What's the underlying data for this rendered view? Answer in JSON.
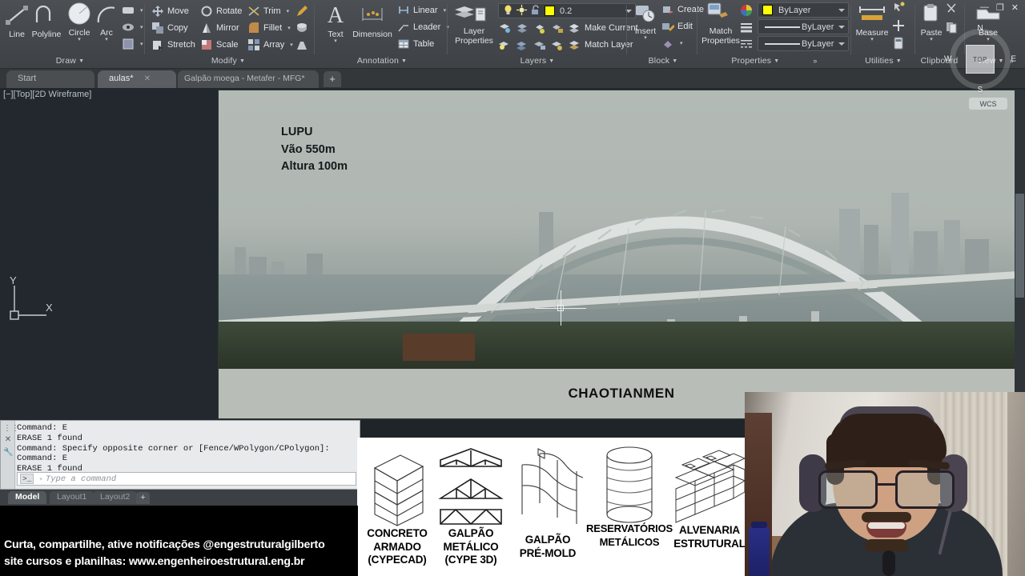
{
  "ribbon": {
    "panels": [
      {
        "name": "Draw",
        "title": "Draw"
      },
      {
        "name": "Modify",
        "title": "Modify"
      },
      {
        "name": "Annotation",
        "title": "Annotation"
      },
      {
        "name": "Layers",
        "title": "Layers"
      },
      {
        "name": "Block",
        "title": "Block"
      },
      {
        "name": "Properties",
        "title": "Properties"
      },
      {
        "name": "Utilities",
        "title": "Utilities"
      },
      {
        "name": "Clipboard",
        "title": "Clipboard"
      },
      {
        "name": "View",
        "title": "View"
      }
    ],
    "draw": {
      "line": "Line",
      "polyline": "Polyline",
      "circle": "Circle",
      "arc": "Arc"
    },
    "modify": {
      "move": "Move",
      "copy": "Copy",
      "stretch": "Stretch",
      "rotate": "Rotate",
      "mirror": "Mirror",
      "scale": "Scale",
      "trim": "Trim",
      "fillet": "Fillet",
      "array": "Array"
    },
    "annotation": {
      "text": "Text",
      "dimension": "Dimension",
      "linear": "Linear",
      "leader": "Leader",
      "table": "Table"
    },
    "layers": {
      "layer_properties_1": "Layer",
      "layer_properties_2": "Properties",
      "current_layer": "0.2",
      "current_layer_color": "#ffff00",
      "make_current": "Make Current",
      "match_layer": "Match Layer"
    },
    "block": {
      "insert": "Insert",
      "create": "Create",
      "edit": "Edit"
    },
    "properties": {
      "match_1": "Match",
      "match_2": "Properties",
      "color": "ByLayer",
      "color_swatch": "#ffff00",
      "linewidth": "ByLayer",
      "linetype": "ByLayer"
    },
    "utilities": {
      "measure": "Measure"
    },
    "clipboard": {
      "paste": "Paste"
    },
    "view": {
      "base": "Base"
    }
  },
  "file_tabs": {
    "tabs": [
      {
        "label": "Start",
        "active": false,
        "closable": false
      },
      {
        "label": "aulas*",
        "active": true,
        "closable": true
      },
      {
        "label": "Galpão moega - Metafer - MFG*",
        "active": false,
        "closable": true
      }
    ],
    "new_tab": "+"
  },
  "viewport": {
    "label": "[−][Top][2D Wireframe]",
    "ucs_x": "X",
    "ucs_y": "Y",
    "viewcube": {
      "face": "TOP",
      "north": "N",
      "south": "S",
      "east": "E",
      "west": "W",
      "coord_system": "WCS"
    },
    "window_buttons": {
      "minimize": "—",
      "maximize": "❐",
      "close": "✕"
    }
  },
  "slide": {
    "annotation": {
      "title": "LUPU",
      "span": "Vão 550m",
      "height": "Altura 100m"
    },
    "caption": "CHAOTIANMEN"
  },
  "command_line": {
    "history": [
      "Command: E",
      "ERASE 1 found",
      "Command: Specify opposite corner or [Fence/WPolygon/CPolygon]:",
      "Command: E",
      "ERASE 1 found"
    ],
    "prompt": ">_",
    "placeholder": "Type a command",
    "close_icon": "✕",
    "tool_icon": "🔧"
  },
  "layout_tabs": {
    "tabs": [
      {
        "label": "Model",
        "active": true
      },
      {
        "label": "Layout1",
        "active": false
      },
      {
        "label": "Layout2",
        "active": false
      }
    ],
    "add": "+"
  },
  "structural_strip": {
    "items": [
      {
        "icon": "concrete-building-isometric",
        "lines": [
          "CONCRETO",
          "ARMADO",
          "(CYPECAD)"
        ]
      },
      {
        "icon": "steel-trusses",
        "lines": [
          "GALPÃO",
          "METÁLICO",
          "(CYPE 3D)"
        ]
      },
      {
        "icon": "precast-frame",
        "lines": [
          "GALPÃO",
          "PRÉ-MOLD"
        ]
      },
      {
        "icon": "cylindrical-tank",
        "lines": [
          "RESERVATÓRIOS",
          "METÁLICOS"
        ]
      },
      {
        "icon": "masonry-blocks",
        "lines": [
          "ALVENARIA",
          "ESTRUTURAL"
        ]
      }
    ]
  },
  "caption_overlay": {
    "line1": "Curta, compartilhe, ative notificações @engestruturalgilberto",
    "line2": "site cursos e planilhas: www.engenheiroestrutural.eng.br"
  }
}
